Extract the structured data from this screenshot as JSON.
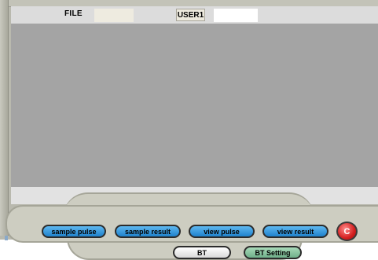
{
  "header": {
    "file_label": "FILE",
    "user_label": "USER1",
    "file_value": "",
    "user_value": ""
  },
  "toolbar": {
    "sample_pulse": "sample pulse",
    "sample_result": "sample result",
    "view_pulse": "view pulse",
    "view_result": "view result",
    "c_button": "C",
    "bt": "BT",
    "bt_setting": "BT Setting"
  },
  "colors": {
    "primary_button": "#1f82cc",
    "close_button": "#d42020",
    "secondary_button": "#6fb08a",
    "display_background": "#a4a4a4"
  }
}
